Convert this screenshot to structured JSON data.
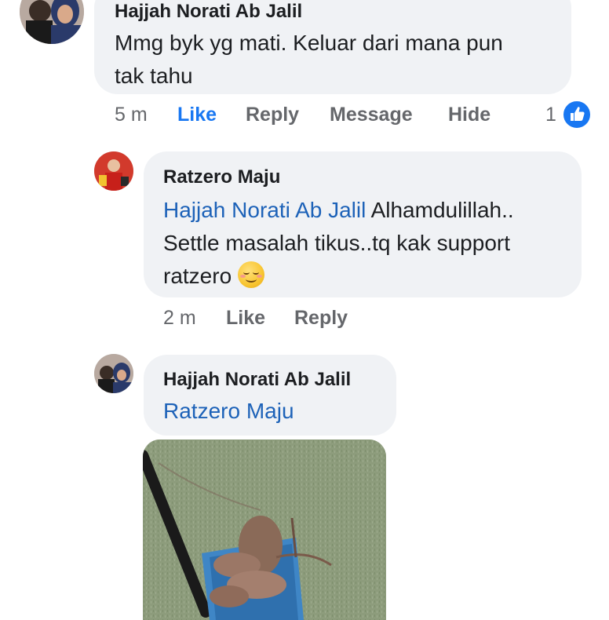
{
  "comments": [
    {
      "author": "Hajjah Norati Ab Jalil",
      "text_line1": "Mmg byk yg mati. Keluar dari mana pun",
      "text_line2": "tak tahu",
      "time": "5 m",
      "actions": [
        "Like",
        "Reply",
        "Message",
        "Hide"
      ],
      "like_count": "1",
      "like_icon": "thumbs-up-icon"
    },
    {
      "author": "Ratzero Maju",
      "mention": "Hajjah Norati Ab Jalil",
      "text_line1_rest": " Alhamdulillah..",
      "text_line2": "Settle masalah tikus..tq kak support",
      "text_line3": "ratzero",
      "emoji": "smiling-face-emoji",
      "time": "2 m",
      "actions": [
        "Like",
        "Reply"
      ]
    },
    {
      "author": "Hajjah Norati Ab Jalil",
      "mention": "Ratzero Maju",
      "attachment": "photo-of-dead-rats-in-blue-basket-on-grass"
    }
  ],
  "colors": {
    "bubble": "#f0f2f5",
    "mention": "#1d62b8",
    "action": "#65676b",
    "like_blue": "#1877f2"
  }
}
